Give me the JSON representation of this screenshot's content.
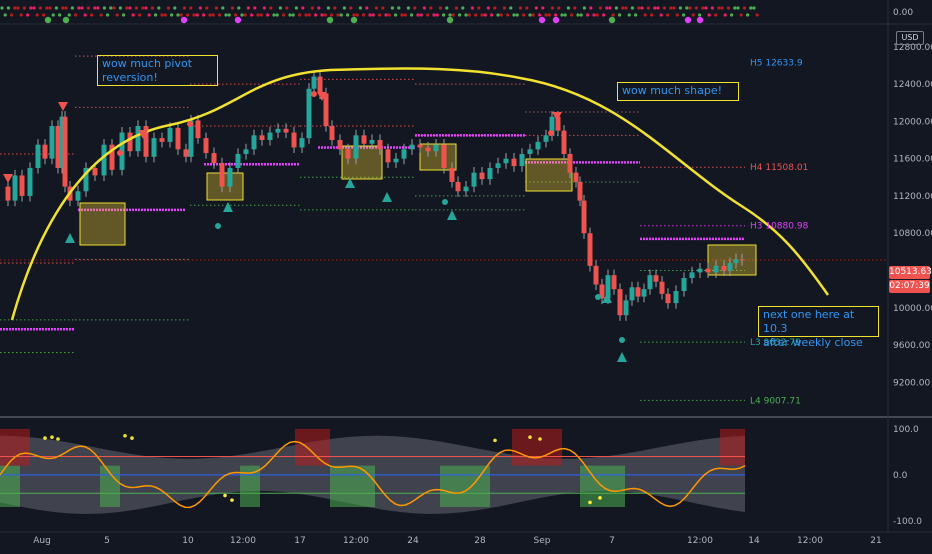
{
  "chart_data": {
    "type": "line",
    "currency_badge": "USD",
    "price_axis": {
      "ticks": [
        "12800.00",
        "12400.00",
        "12000.00",
        "11600.00",
        "11200.00",
        "10800.00",
        "10000.00",
        "9600.00",
        "9200.00"
      ],
      "range": [
        8850,
        12980
      ]
    },
    "top_indicator": {
      "value_label": "0.00"
    },
    "oscillator_axis": {
      "ticks": [
        "100.0",
        "0.0",
        "-100.0"
      ],
      "range": [
        -120,
        115
      ]
    },
    "time_axis": {
      "ticks": [
        "Aug",
        "5",
        "10",
        "12:00",
        "17",
        "12:00",
        "24",
        "28",
        "Sep",
        "7",
        "12:00",
        "14",
        "12:00",
        "21"
      ]
    },
    "last_price": {
      "value": "10513.63",
      "countdown": "02:07:39",
      "level": 10513.63
    },
    "pivot_labels": [
      {
        "text": "H5 12633.9",
        "price": 12633.9,
        "color": "#2f96f3"
      },
      {
        "text": "H4 11508.01",
        "price": 11508.01,
        "color": "#ef5350"
      },
      {
        "text": "H3 10880.98",
        "price": 10880.98,
        "color": "#e040fb"
      },
      {
        "text": "L3 9632.79",
        "price": 9632.79,
        "color": "#26a69a"
      },
      {
        "text": "L4 9007.71",
        "price": 9007.71,
        "color": "#4caf50"
      }
    ],
    "annotations": [
      {
        "id": "ann1",
        "text": "wow much pivot\nreversion!"
      },
      {
        "id": "ann2",
        "text": "wow much shape!"
      },
      {
        "id": "ann3",
        "text": "next one here at 10.3\nafter weekly close"
      }
    ],
    "price_series_approx": [
      [
        0,
        11300
      ],
      [
        8,
        11150
      ],
      [
        15,
        11420
      ],
      [
        22,
        11200
      ],
      [
        30,
        11500
      ],
      [
        38,
        11750
      ],
      [
        45,
        11600
      ],
      [
        52,
        11950
      ],
      [
        58,
        11500
      ],
      [
        62,
        12050
      ],
      [
        65,
        11300
      ],
      [
        70,
        11150
      ],
      [
        78,
        11250
      ],
      [
        86,
        11500
      ],
      [
        95,
        11420
      ],
      [
        104,
        11750
      ],
      [
        112,
        11480
      ],
      [
        122,
        11880
      ],
      [
        130,
        11680
      ],
      [
        138,
        11950
      ],
      [
        146,
        11620
      ],
      [
        154,
        11820
      ],
      [
        162,
        11780
      ],
      [
        170,
        11930
      ],
      [
        178,
        11700
      ],
      [
        186,
        11620
      ],
      [
        191,
        12010
      ],
      [
        198,
        11820
      ],
      [
        206,
        11660
      ],
      [
        214,
        11550
      ],
      [
        222,
        11300
      ],
      [
        230,
        11500
      ],
      [
        238,
        11650
      ],
      [
        246,
        11700
      ],
      [
        254,
        11850
      ],
      [
        262,
        11800
      ],
      [
        270,
        11880
      ],
      [
        278,
        11920
      ],
      [
        286,
        11880
      ],
      [
        294,
        11720
      ],
      [
        302,
        11820
      ],
      [
        309,
        12350
      ],
      [
        314,
        12480
      ],
      [
        320,
        12300
      ],
      [
        326,
        11950
      ],
      [
        332,
        11800
      ],
      [
        340,
        11700
      ],
      [
        348,
        11600
      ],
      [
        356,
        11850
      ],
      [
        364,
        11760
      ],
      [
        372,
        11800
      ],
      [
        380,
        11700
      ],
      [
        388,
        11560
      ],
      [
        396,
        11600
      ],
      [
        404,
        11700
      ],
      [
        412,
        11750
      ],
      [
        420,
        11720
      ],
      [
        428,
        11680
      ],
      [
        436,
        11750
      ],
      [
        444,
        11500
      ],
      [
        452,
        11350
      ],
      [
        458,
        11250
      ],
      [
        466,
        11300
      ],
      [
        474,
        11450
      ],
      [
        482,
        11380
      ],
      [
        490,
        11500
      ],
      [
        498,
        11550
      ],
      [
        506,
        11600
      ],
      [
        514,
        11520
      ],
      [
        522,
        11650
      ],
      [
        530,
        11700
      ],
      [
        538,
        11780
      ],
      [
        546,
        11850
      ],
      [
        552,
        12050
      ],
      [
        558,
        11900
      ],
      [
        564,
        11650
      ],
      [
        570,
        11450
      ],
      [
        576,
        11350
      ],
      [
        580,
        11150
      ],
      [
        584,
        10800
      ],
      [
        590,
        10450
      ],
      [
        596,
        10250
      ],
      [
        602,
        10100
      ],
      [
        608,
        10350
      ],
      [
        614,
        10200
      ],
      [
        620,
        9920
      ],
      [
        626,
        10080
      ],
      [
        632,
        10220
      ],
      [
        638,
        10120
      ],
      [
        644,
        10200
      ],
      [
        650,
        10350
      ],
      [
        656,
        10280
      ],
      [
        662,
        10150
      ],
      [
        668,
        10050
      ],
      [
        676,
        10180
      ],
      [
        684,
        10320
      ],
      [
        692,
        10380
      ],
      [
        700,
        10420
      ],
      [
        708,
        10380
      ],
      [
        716,
        10450
      ],
      [
        724,
        10400
      ],
      [
        730,
        10480
      ],
      [
        736,
        10520
      ],
      [
        742,
        10513
      ]
    ],
    "grid": false,
    "legend": "none"
  }
}
